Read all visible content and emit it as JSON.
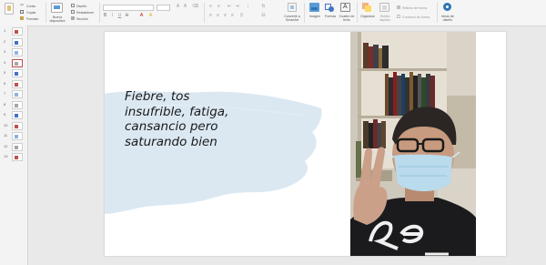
{
  "ribbon": {
    "clipboard": {
      "paste": "",
      "cut": "Cortar",
      "copy": "Copiar",
      "format_painter": "Formato"
    },
    "slides": {
      "new_slide": "Nueva diapositiva",
      "layout": "Diseño",
      "reset": "Restablecer",
      "section": "Sección"
    },
    "groups": {
      "convert_smartart": "Convertir a SmartArt",
      "images": "Imagen",
      "shapes": "Formas",
      "textbox": "Cuadro de texto",
      "arrange": "Organizar",
      "quick_styles": "Estilos rápidos",
      "shape_fill": "Relleno de forma",
      "shape_outline": "Contorno de forma",
      "designer": "Ideas de diseño"
    }
  },
  "thumbnails": {
    "numbers": [
      "1",
      "2",
      "3",
      "4",
      "5",
      "6",
      "7",
      "8",
      "9",
      "10",
      "11",
      "12",
      "13"
    ],
    "active_index": 3
  },
  "slide": {
    "lines": [
      "Fiebre, tos",
      "insufrible, fatiga,",
      "cansancio pero",
      "saturando bien"
    ]
  },
  "colors": {
    "brush": "#dbe8f2",
    "accent": "#c0504d"
  }
}
